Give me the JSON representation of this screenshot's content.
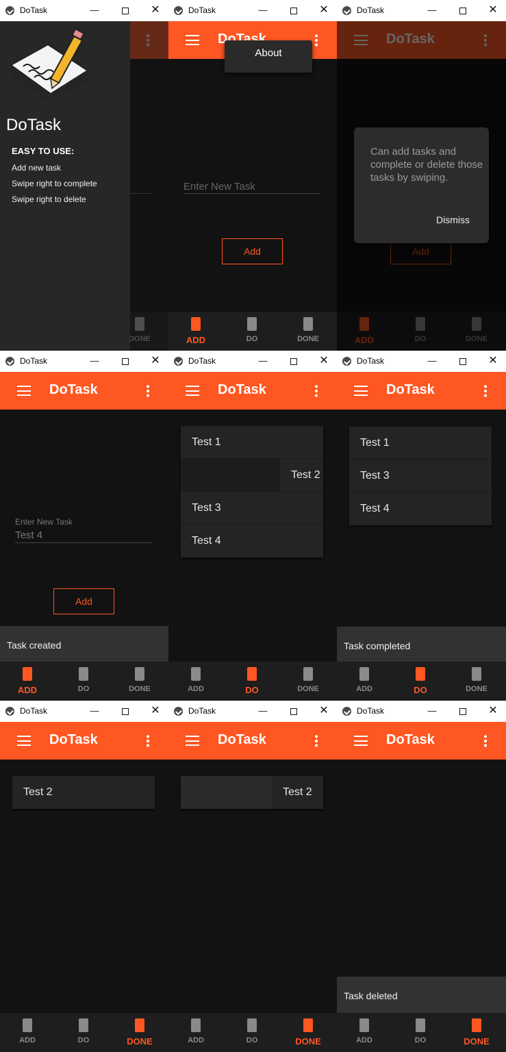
{
  "app_title": "DoTask",
  "window_controls": {
    "minimize": "—",
    "close": "✕"
  },
  "nav": {
    "add": "ADD",
    "do": "DO",
    "done": "DONE"
  },
  "drawer": {
    "title": "DoTask",
    "heading": "EASY TO USE:",
    "items": [
      "Add new task",
      "Swipe right to complete",
      "Swipe right to delete"
    ]
  },
  "menu": {
    "about": "About"
  },
  "dialog": {
    "text": "Can add tasks and complete or delete those tasks by swiping.",
    "dismiss": "Dismiss"
  },
  "input": {
    "placeholder": "Enter New Task",
    "label": "Enter New Task",
    "value": "Test 4"
  },
  "add_button": "Add",
  "tasks_all": [
    "Test 1",
    "Test 2",
    "Test 3",
    "Test 4"
  ],
  "tasks_remaining": [
    "Test 1",
    "Test 3",
    "Test 4"
  ],
  "tasks_done": [
    "Test 2"
  ],
  "snack": {
    "created": "Task created",
    "completed": "Task completed",
    "deleted": "Task deleted"
  },
  "colors": {
    "accent": "#ff5722",
    "background": "#121212",
    "surface": "#242424"
  }
}
